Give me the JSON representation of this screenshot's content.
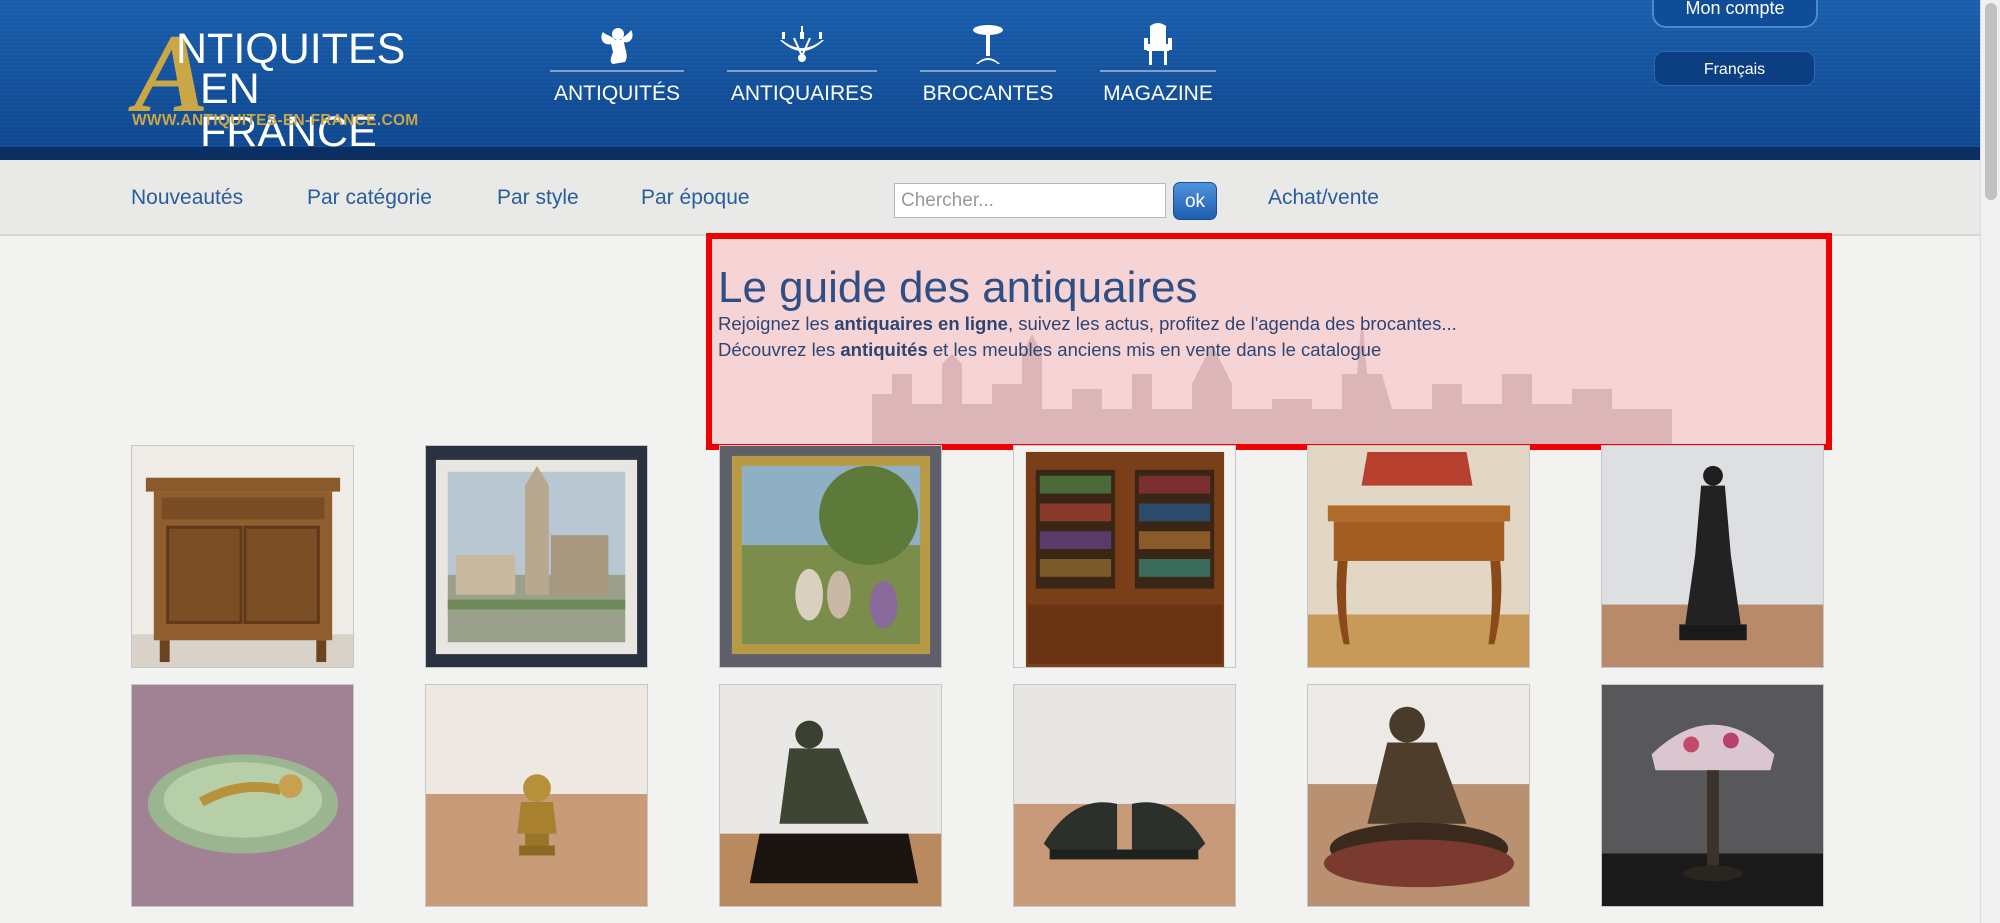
{
  "header": {
    "logo": {
      "line1": "NTIQUITES",
      "line2": "EN FRANCE",
      "big_letter": "A",
      "url": "WWW.ANTIQUITES-EN-FRANCE.COM"
    },
    "nav": [
      {
        "label": "ANTIQUITÉS",
        "icon": "cherub-icon"
      },
      {
        "label": "ANTIQUAIRES",
        "icon": "chandelier-icon"
      },
      {
        "label": "BROCANTES",
        "icon": "pedestal-table-icon"
      },
      {
        "label": "MAGAZINE",
        "icon": "armchair-icon"
      }
    ],
    "account_label": "Mon compte",
    "language_label": "Français"
  },
  "subnav": {
    "links": [
      "Nouveautés",
      "Par catégorie",
      "Par style",
      "Par époque"
    ],
    "search_placeholder": "Chercher...",
    "search_button": "ok",
    "buy_sell_label": "Achat/vente"
  },
  "hero": {
    "title": "Le guide des antiquaires",
    "line1_pre": "Rejoignez les ",
    "line1_bold": "antiquaires en ligne",
    "line1_post": ", suivez les actus, profitez de l'agenda des brocantes...",
    "line2_pre": "Découvrez les ",
    "line2_bold": "antiquités",
    "line2_post": " et les meubles anciens mis en vente dans le catalogue"
  },
  "products": [
    {
      "id": "p1",
      "name": "wooden-cabinet"
    },
    {
      "id": "p2",
      "name": "church-painting"
    },
    {
      "id": "p3",
      "name": "garden-painting"
    },
    {
      "id": "p4",
      "name": "bookcase"
    },
    {
      "id": "p5",
      "name": "writing-desk"
    },
    {
      "id": "p6",
      "name": "venus-statue"
    },
    {
      "id": "p7",
      "name": "onyx-dish"
    },
    {
      "id": "p8",
      "name": "bronze-bust"
    },
    {
      "id": "p9",
      "name": "seated-faun-sculpture"
    },
    {
      "id": "p10",
      "name": "bird-bookends"
    },
    {
      "id": "p11",
      "name": "seated-child-sculpture"
    },
    {
      "id": "p12",
      "name": "glass-lamp"
    }
  ],
  "colors": {
    "header_blue": "#114f9a",
    "link_blue": "#2a5d9f",
    "logo_gold": "#c9a646",
    "highlight_red": "#f00000"
  }
}
